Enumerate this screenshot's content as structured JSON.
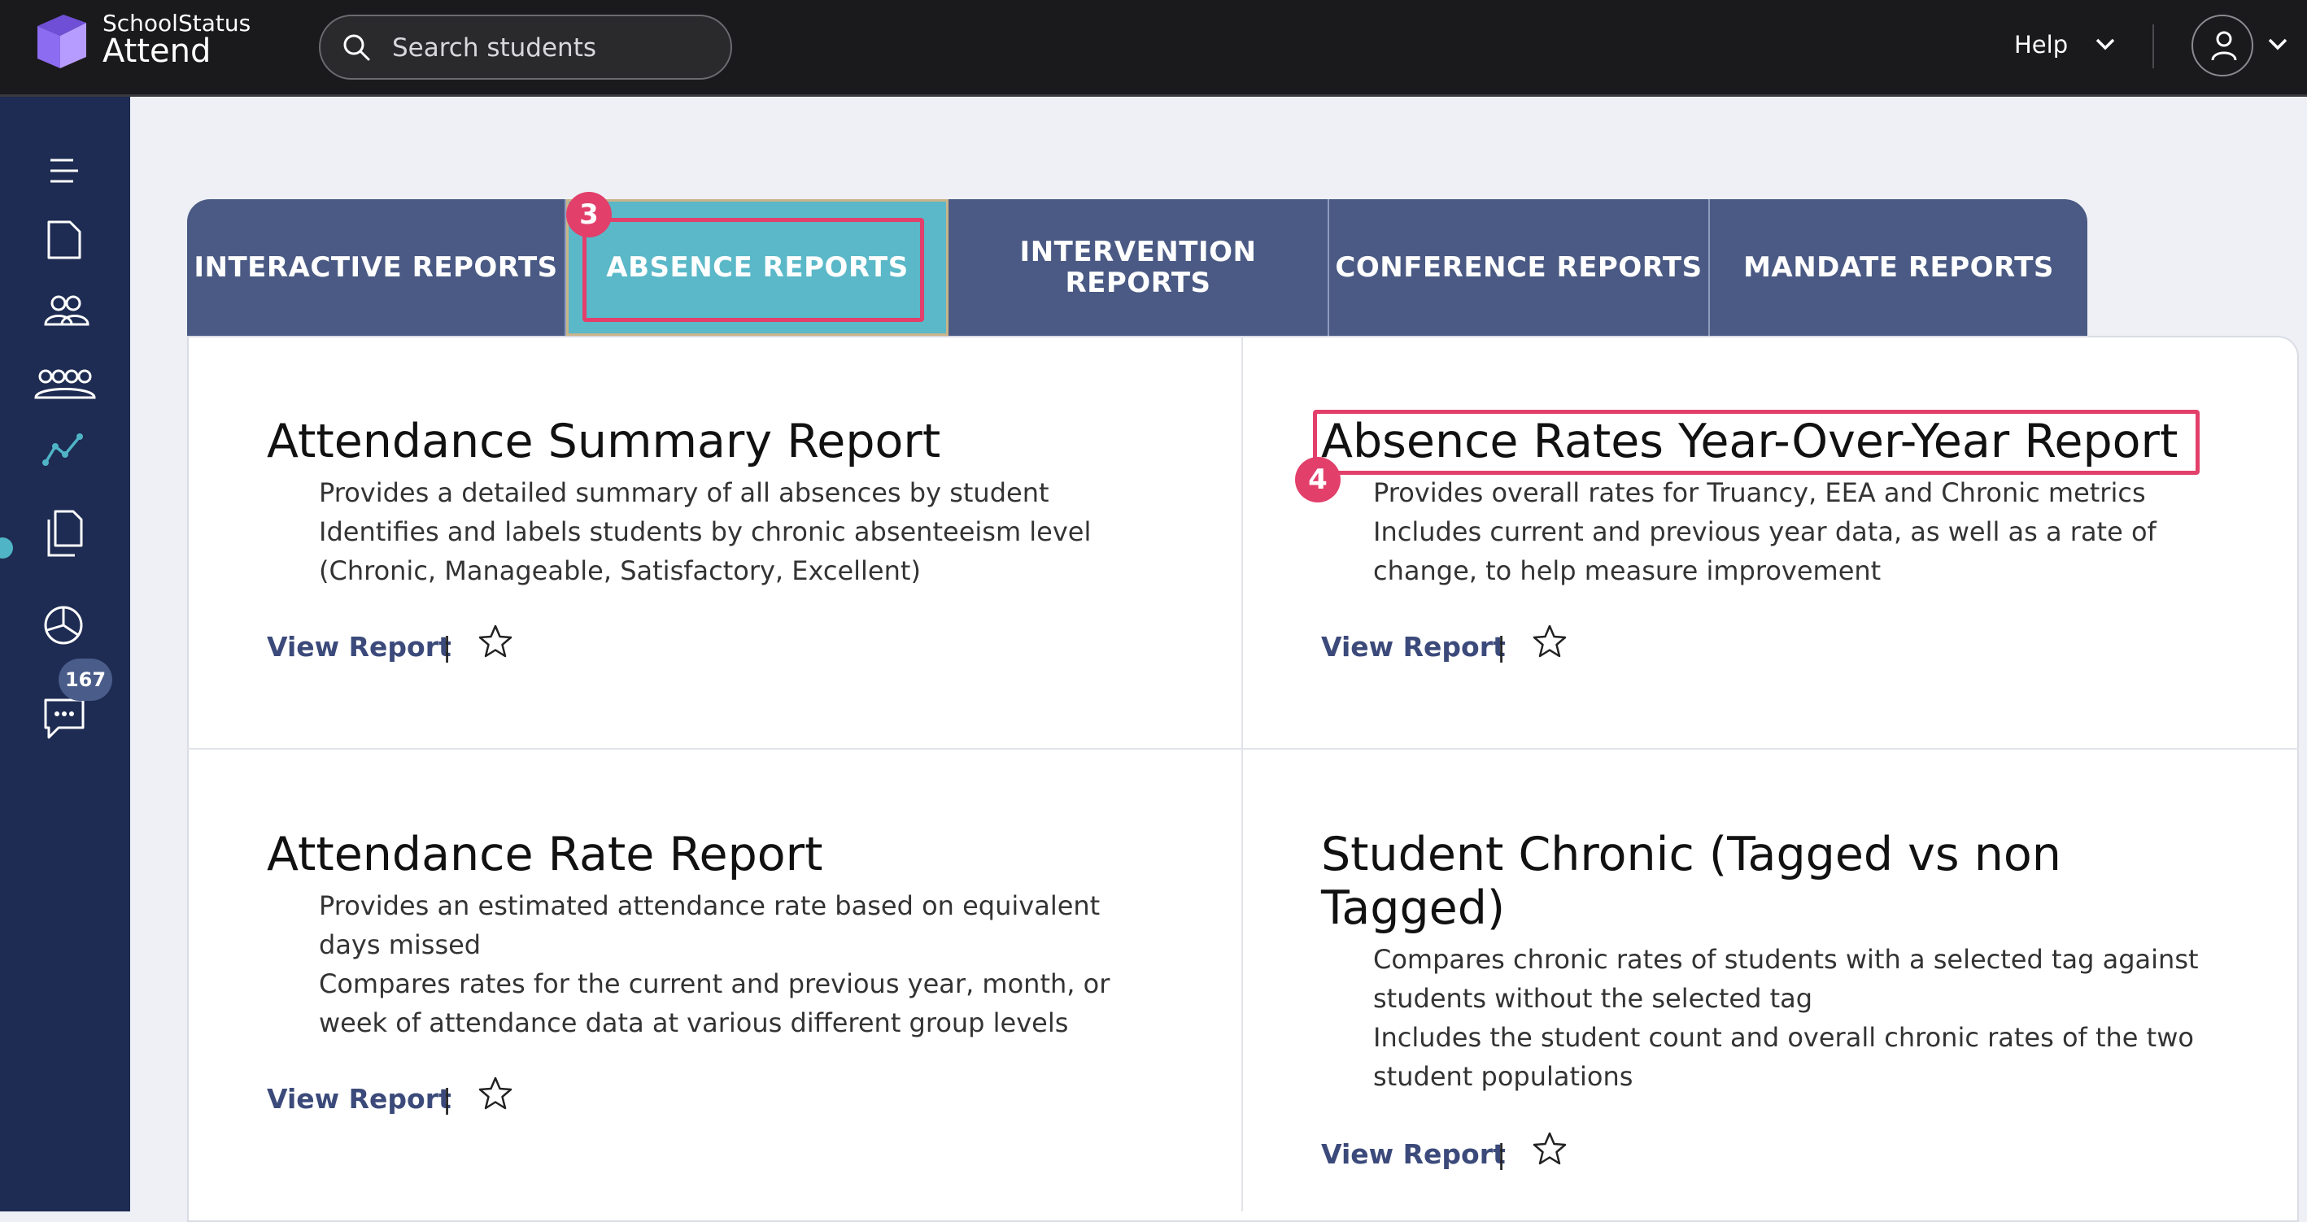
{
  "header": {
    "brand_top": "SchoolStatus",
    "brand_bottom": "Attend",
    "search_placeholder": "Search students",
    "help_label": "Help"
  },
  "sidebar": {
    "items": [
      {
        "icon": "menu-icon"
      },
      {
        "icon": "document-icon"
      },
      {
        "icon": "users-icon"
      },
      {
        "icon": "groups-icon"
      },
      {
        "icon": "reports-chart-icon",
        "active": true
      },
      {
        "icon": "copy-icon"
      },
      {
        "icon": "dashboard-icon"
      },
      {
        "icon": "chat-icon",
        "badge": "167"
      }
    ],
    "accent_color": "#4fb4c6"
  },
  "tabs": [
    {
      "label": "INTERACTIVE REPORTS"
    },
    {
      "label": "ABSENCE REPORTS",
      "active": true
    },
    {
      "label": "INTERVENTION REPORTS"
    },
    {
      "label": "CONFERENCE REPORTS"
    },
    {
      "label": "MANDATE REPORTS"
    }
  ],
  "annotations": {
    "step3": "3",
    "step4": "4",
    "color": "#e23f6b"
  },
  "reports": [
    {
      "title": "Attendance Summary Report",
      "lines": [
        "Provides a detailed summary of all absences by student",
        "Identifies and labels students by chronic absenteeism level",
        "(Chronic, Manageable, Satisfactory, Excellent)"
      ],
      "link": "View Report",
      "sep": "|"
    },
    {
      "title": "Absence Rates Year-Over-Year Report",
      "lines": [
        "Provides overall rates for Truancy, EEA and Chronic metrics",
        "Includes current and previous year data, as well as a rate of",
        "change, to help measure improvement"
      ],
      "link": "View Report",
      "sep": "|"
    },
    {
      "title": "Attendance Rate Report",
      "lines": [
        "Provides an estimated attendance rate based on equivalent",
        "days missed",
        "Compares rates for the current and previous year, month, or",
        "week of attendance data at various different group levels"
      ],
      "link": "View Report",
      "sep": "|"
    },
    {
      "title_line1": "Student Chronic (Tagged vs non",
      "title_line2": "Tagged)",
      "lines": [
        "Compares chronic rates of students with a selected tag against",
        "students without the selected tag",
        "Includes the student count and overall chronic rates of the two",
        "student populations"
      ],
      "link": "View Report",
      "sep": "|"
    }
  ]
}
